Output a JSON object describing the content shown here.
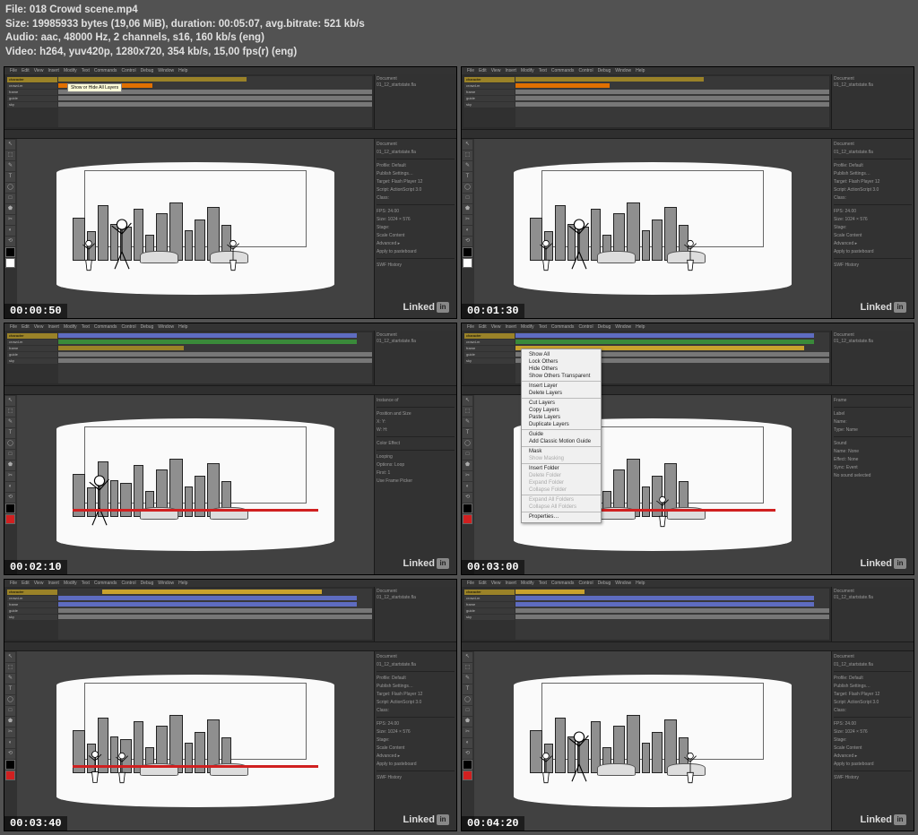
{
  "header": {
    "file_label": "File:",
    "file_value": "018 Crowd scene.mp4",
    "size_label": "Size:",
    "size_value": "19985933 bytes (19,06 MiB), duration: 00:05:07, avg.bitrate: 521 kb/s",
    "audio_label": "Audio:",
    "audio_value": "aac, 48000 Hz, 2 channels, s16, 160 kb/s (eng)",
    "video_label": "Video:",
    "video_value": "h264, yuv420p, 1280x720, 354 kb/s, 15,00 fps(r) (eng)"
  },
  "menubar": [
    "File",
    "Edit",
    "View",
    "Insert",
    "Modify",
    "Text",
    "Commands",
    "Control",
    "Debug",
    "Window",
    "Help"
  ],
  "layers": [
    "character",
    "crowd-m",
    "frame",
    "guide",
    "sky"
  ],
  "props": {
    "doc_label": "Document",
    "doc_value": "01_12_startstate.fla",
    "profile": "Profile: Default",
    "publish": "Publish Settings…",
    "target": "Target: Flash Player 12",
    "script": "Script: ActionScript 3.0",
    "class": "Class:",
    "fps": "FPS: 24.00",
    "size": "Size: 1024 × 576",
    "stage": "Stage:",
    "swf_hist": "SWF History",
    "scale_content": "Scale Content",
    "advanced": "Advanced ▸",
    "apply": "Apply to pasteboard"
  },
  "frame_props": {
    "frame_label": "Frame",
    "name": "Name:",
    "type": "Type: Name",
    "sound": "Sound",
    "sound_name": "Name: None",
    "effect": "Effect: None",
    "sync": "Sync: Event",
    "no_sound": "No sound selected"
  },
  "instance_props": {
    "instance": "Instance of",
    "pos_size": "Position and Size",
    "x": "X:",
    "y": "Y:",
    "w": "W:",
    "h": "H:",
    "color_effect": "Color Effect",
    "looping": "Looping",
    "options": "Options: Loop",
    "first": "First: 1",
    "edit_multi": "Use Frame Picker"
  },
  "tooltip": "Show or Hide All Layers",
  "context_menu": [
    "Show All",
    "Lock Others",
    "Hide Others",
    "Show Others Transparent",
    "",
    "Insert Layer",
    "Delete Layers",
    "",
    "Cut Layers",
    "Copy Layers",
    "Paste Layers",
    "Duplicate Layers",
    "",
    "Guide",
    "Add Classic Motion Guide",
    "",
    "Mask",
    "Show Masking",
    "",
    "Insert Folder",
    "Delete Folder",
    "Expand Folder",
    "Collapse Folder",
    "",
    "Expand All Folders",
    "Collapse All Folders",
    "",
    "Properties…"
  ],
  "watermark": "Linked",
  "timestamps": [
    "00:00:50",
    "00:01:30",
    "00:02:10",
    "00:03:00",
    "00:03:40",
    "00:04:20"
  ],
  "toolbar_icons": [
    "↖",
    "⬚",
    "✎",
    "T",
    "◯",
    "□",
    "⬟",
    "✂",
    "◐",
    "⟲"
  ]
}
